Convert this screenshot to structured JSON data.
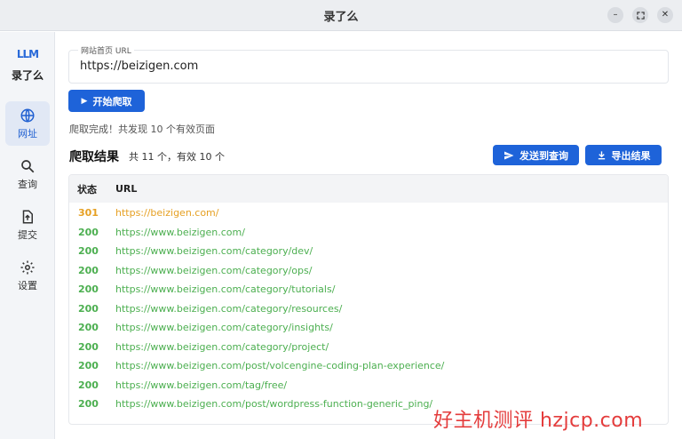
{
  "window": {
    "title": "录了么"
  },
  "sidebar": {
    "logo_mark": "LLM",
    "logo_name": "录了么",
    "items": [
      {
        "label": "网址",
        "icon": "globe-icon",
        "active": true
      },
      {
        "label": "查询",
        "icon": "search-icon",
        "active": false
      },
      {
        "label": "提交",
        "icon": "upload-icon",
        "active": false
      },
      {
        "label": "设置",
        "icon": "gear-icon",
        "active": false
      }
    ]
  },
  "form": {
    "url_label": "网站首页 URL",
    "url_value": "https://beizigen.com",
    "start_button": "开始爬取"
  },
  "status_message": "爬取完成！共发现 10 个有效页面",
  "results": {
    "title": "爬取结果",
    "summary": "共 11 个，有效 10 个",
    "send_button": "发送到查询",
    "export_button": "导出结果",
    "columns": {
      "status": "状态",
      "url": "URL"
    },
    "rows": [
      {
        "status": "301",
        "url": "https://beizigen.com/",
        "color": "#e6a023"
      },
      {
        "status": "200",
        "url": "https://www.beizigen.com/",
        "color": "#4caf50"
      },
      {
        "status": "200",
        "url": "https://www.beizigen.com/category/dev/",
        "color": "#4caf50"
      },
      {
        "status": "200",
        "url": "https://www.beizigen.com/category/ops/",
        "color": "#4caf50"
      },
      {
        "status": "200",
        "url": "https://www.beizigen.com/category/tutorials/",
        "color": "#4caf50"
      },
      {
        "status": "200",
        "url": "https://www.beizigen.com/category/resources/",
        "color": "#4caf50"
      },
      {
        "status": "200",
        "url": "https://www.beizigen.com/category/insights/",
        "color": "#4caf50"
      },
      {
        "status": "200",
        "url": "https://www.beizigen.com/category/project/",
        "color": "#4caf50"
      },
      {
        "status": "200",
        "url": "https://www.beizigen.com/post/volcengine-coding-plan-experience/",
        "color": "#4caf50"
      },
      {
        "status": "200",
        "url": "https://www.beizigen.com/tag/free/",
        "color": "#4caf50"
      },
      {
        "status": "200",
        "url": "https://www.beizigen.com/post/wordpress-function-generic_ping/",
        "color": "#4caf50"
      }
    ]
  },
  "watermark": "好主机测评 hzjcp.com",
  "colors": {
    "accent": "#1e63d9",
    "status_ok": "#4caf50",
    "status_redirect": "#e6a023"
  }
}
